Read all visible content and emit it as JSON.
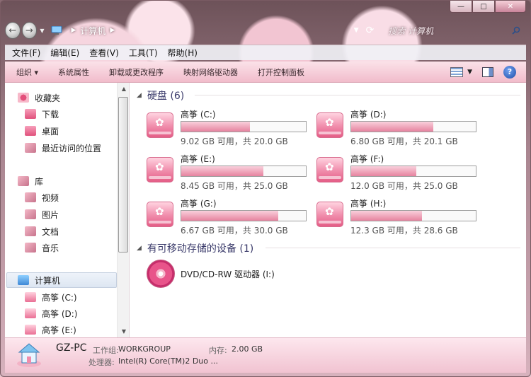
{
  "window": {
    "caption": {
      "minimize": "—",
      "maximize": "□",
      "close": "✕"
    }
  },
  "address": {
    "back": "←",
    "forward": "→",
    "path": "计算机",
    "search_placeholder": "搜索 计算机"
  },
  "menu": [
    "文件(F)",
    "编辑(E)",
    "查看(V)",
    "工具(T)",
    "帮助(H)"
  ],
  "toolbar": {
    "organize": "组织 ▾",
    "system_properties": "系统属性",
    "uninstall": "卸载或更改程序",
    "map_drive": "映射网络驱动器",
    "control_panel": "打开控制面板",
    "help": "?"
  },
  "sidebar": {
    "favorites": "收藏夹",
    "downloads": "下载",
    "desktop": "桌面",
    "recent": "最近访问的位置",
    "libraries": "库",
    "videos": "视频",
    "pictures": "图片",
    "documents": "文档",
    "music": "音乐",
    "computer": "计算机",
    "drive_c": "高筝 (C:)",
    "drive_d": "高筝 (D:)",
    "drive_e": "高筝 (E:)"
  },
  "content": {
    "hard_disks_header": "硬盘 (6)",
    "removable_header": "有可移动存储的设备 (1)",
    "dvd_label": "DVD/CD-RW 驱动器 (I:)",
    "drives": [
      {
        "name": "高筝 (C:)",
        "size": "9.02 GB 可用，共 20.0 GB",
        "used_fraction": 0.55
      },
      {
        "name": "高筝 (D:)",
        "size": "6.80 GB 可用，共 20.1 GB",
        "used_fraction": 0.66
      },
      {
        "name": "高筝 (E:)",
        "size": "8.45 GB 可用，共 25.0 GB",
        "used_fraction": 0.66
      },
      {
        "name": "高筝 (F:)",
        "size": "12.0 GB 可用，共 25.0 GB",
        "used_fraction": 0.52
      },
      {
        "name": "高筝 (G:)",
        "size": "6.67 GB 可用，共 30.0 GB",
        "used_fraction": 0.78
      },
      {
        "name": "高筝 (H:)",
        "size": "12.3 GB 可用，共 28.6 GB",
        "used_fraction": 0.57
      }
    ]
  },
  "details": {
    "computer_name": "GZ-PC",
    "workgroup_label": "工作组:",
    "workgroup_value": "WORKGROUP",
    "memory_label": "内存:",
    "memory_value": "2.00 GB",
    "cpu_label": "处理器:",
    "cpu_value": "Intel(R) Core(TM)2 Duo ..."
  }
}
